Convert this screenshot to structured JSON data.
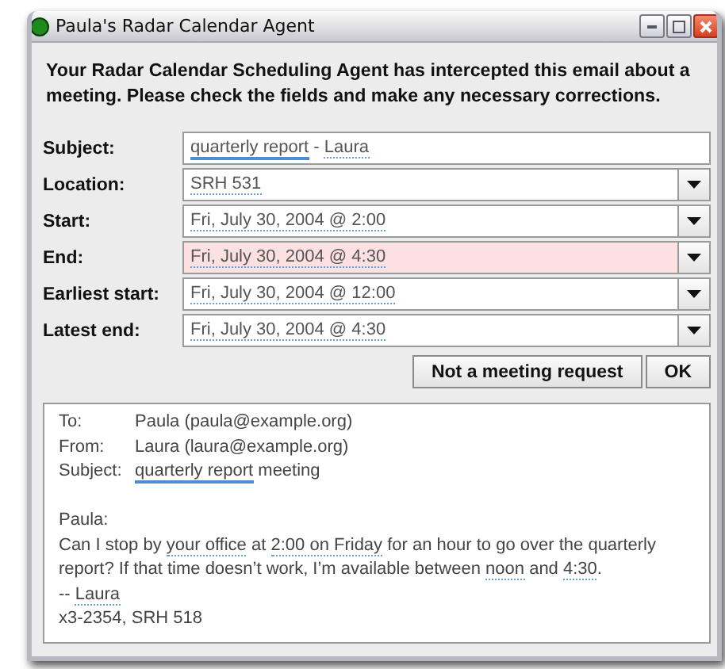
{
  "window": {
    "title": "Paula's Radar Calendar Agent"
  },
  "intro": "Your Radar Calendar Scheduling Agent has intercepted this email about a meeting. Please check the fields and make any necessary corrections.",
  "fields": [
    {
      "label": "Subject:",
      "kind": "text",
      "flagged": false,
      "value": [
        {
          "text": "quarterly report",
          "highlighted": true
        },
        {
          "text": " - "
        },
        {
          "text": "Laura",
          "recognized": true
        }
      ]
    },
    {
      "label": "Location:",
      "kind": "combo",
      "flagged": false,
      "value": [
        {
          "text": "SRH 531",
          "recognized": true
        }
      ]
    },
    {
      "label": "Start:",
      "kind": "combo",
      "flagged": false,
      "value": [
        {
          "text": "Fri, July 30, 2004 @ 2:00",
          "recognized": true
        }
      ]
    },
    {
      "label": "End:",
      "kind": "combo",
      "flagged": true,
      "value": [
        {
          "text": "Fri, July 30, 2004 @ 4:30",
          "recognized": true
        }
      ]
    },
    {
      "label": "Earliest start:",
      "kind": "combo",
      "flagged": false,
      "value": [
        {
          "text": "Fri, July 30, 2004 @ 12:00",
          "recognized": true
        }
      ]
    },
    {
      "label": "Latest end:",
      "kind": "combo",
      "flagged": false,
      "value": [
        {
          "text": "Fri, July 30, 2004 @ 4:30",
          "recognized": true
        }
      ]
    }
  ],
  "buttons": [
    "Not a meeting request",
    "OK"
  ],
  "email": {
    "headers": [
      {
        "label": "To:",
        "value": [
          {
            "text": "Paula (paula@example.org)"
          }
        ]
      },
      {
        "label": "From:",
        "value": [
          {
            "text": "Laura (laura@example.org)"
          }
        ]
      },
      {
        "label": "Subject:",
        "value": [
          {
            "text": "quarterly report",
            "highlighted": true
          },
          {
            "text": " meeting"
          }
        ]
      }
    ],
    "lines": [
      [
        {
          "text": "Paula:"
        }
      ],
      [
        {
          "text": "Can I stop by "
        },
        {
          "text": "your office",
          "recognized": true
        },
        {
          "text": " at "
        },
        {
          "text": "2:00 on Friday",
          "recognized": true
        },
        {
          "text": " for an hour to go over the quarterly"
        }
      ],
      [
        {
          "text": "report? If that time doesn’t work, I’m available between "
        },
        {
          "text": "noon",
          "recognized": true
        },
        {
          "text": " and "
        },
        {
          "text": "4:30",
          "recognized": true
        },
        {
          "text": "."
        }
      ],
      [
        {
          "text": "-- "
        },
        {
          "text": "Laura",
          "recognized": true
        }
      ],
      [
        {
          "text": "x3-2354, SRH 518"
        }
      ]
    ]
  }
}
